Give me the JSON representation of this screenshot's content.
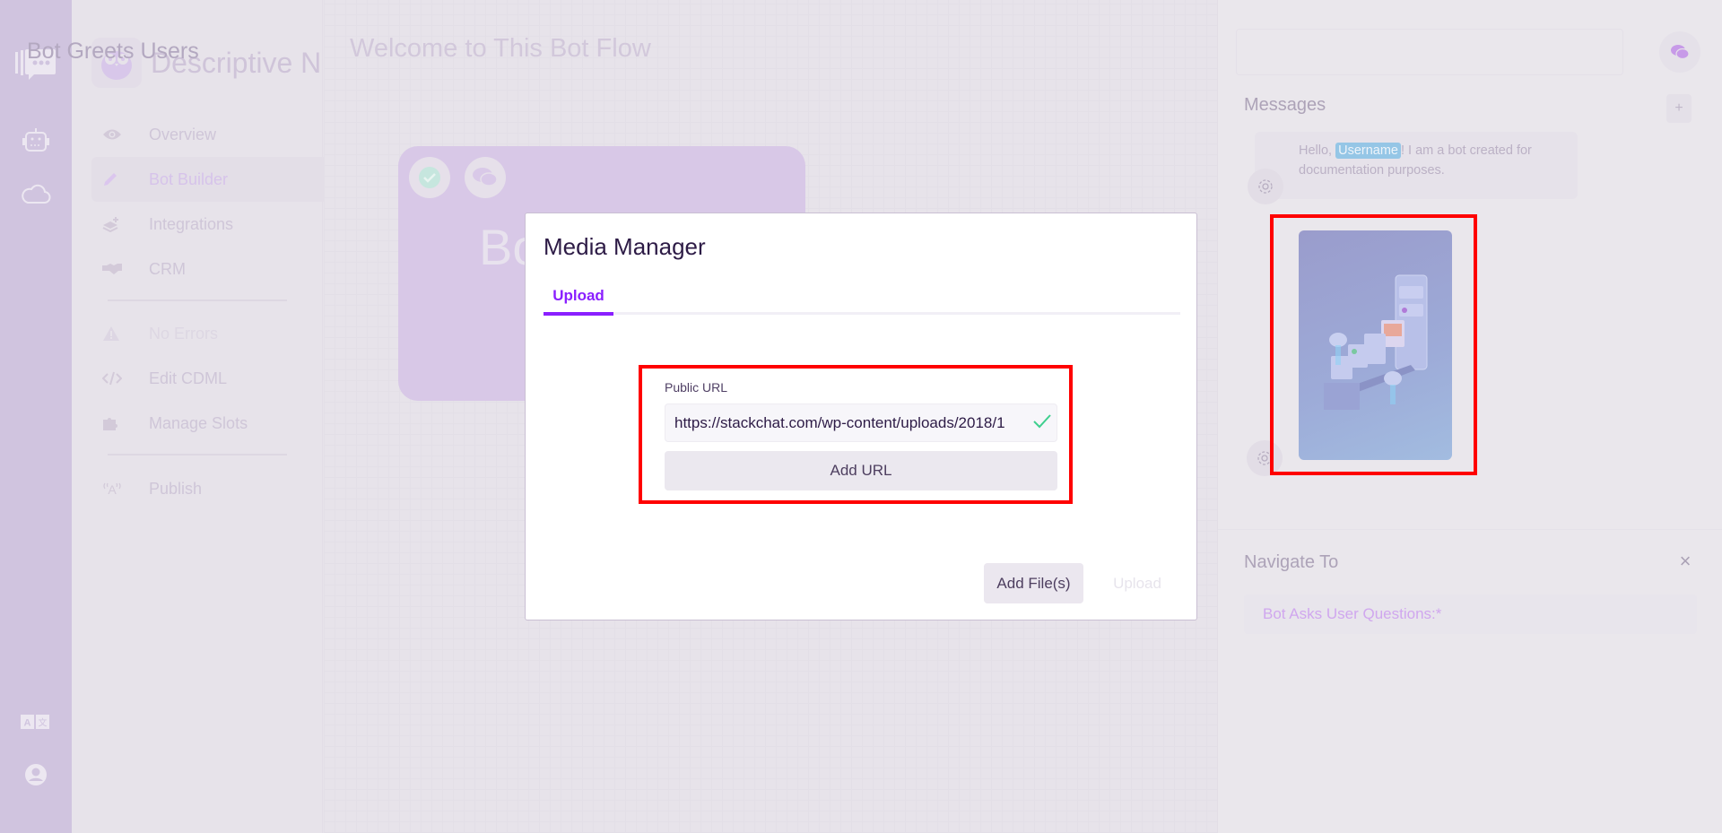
{
  "rail": {
    "icons": [
      "stackchat-logo-icon",
      "bot-icon",
      "cloud-icon",
      "translate-icon",
      "user-account-icon"
    ]
  },
  "nav": {
    "bot_name": "Descriptive N",
    "items": [
      {
        "label": "Overview",
        "icon": "eye-icon",
        "state": "normal"
      },
      {
        "label": "Bot Builder",
        "icon": "pencil-icon",
        "state": "active"
      },
      {
        "label": "Integrations",
        "icon": "layers-plus-icon",
        "state": "normal"
      },
      {
        "label": "CRM",
        "icon": "handshake-icon",
        "state": "normal"
      },
      {
        "label": "No Errors",
        "icon": "warning-icon",
        "state": "disabled"
      },
      {
        "label": "Edit CDML",
        "icon": "code-icon",
        "state": "normal"
      },
      {
        "label": "Manage Slots",
        "icon": "puzzle-icon",
        "state": "normal"
      },
      {
        "label": "Publish",
        "icon": "broadcast-icon",
        "state": "normal"
      }
    ]
  },
  "canvas": {
    "title": "Welcome to This Bot Flow",
    "node_title_partial": "Bo"
  },
  "panel": {
    "title": "Bot Greets Users",
    "messages_label": "Messages",
    "add_label": "+",
    "message": {
      "prefix": "Hello, ",
      "variable": "Username",
      "suffix": "! I am a bot created for documentation purposes."
    },
    "navigate_label": "Navigate To",
    "close_label": "×",
    "navigate_target": "Bot Asks User Questions:*"
  },
  "modal": {
    "title": "Media Manager",
    "tabs": [
      {
        "label": "Upload",
        "active": true
      }
    ],
    "field_label": "Public URL",
    "url_value": "https://stackchat.com/wp-content/uploads/2018/1",
    "add_url_label": "Add URL",
    "add_files_label": "Add File(s)",
    "upload_label": "Upload"
  },
  "colors": {
    "accent": "#8a1fff",
    "highlight": "#ff0000",
    "success": "#3ecf8e",
    "variable_chip": "#95c6e6"
  }
}
